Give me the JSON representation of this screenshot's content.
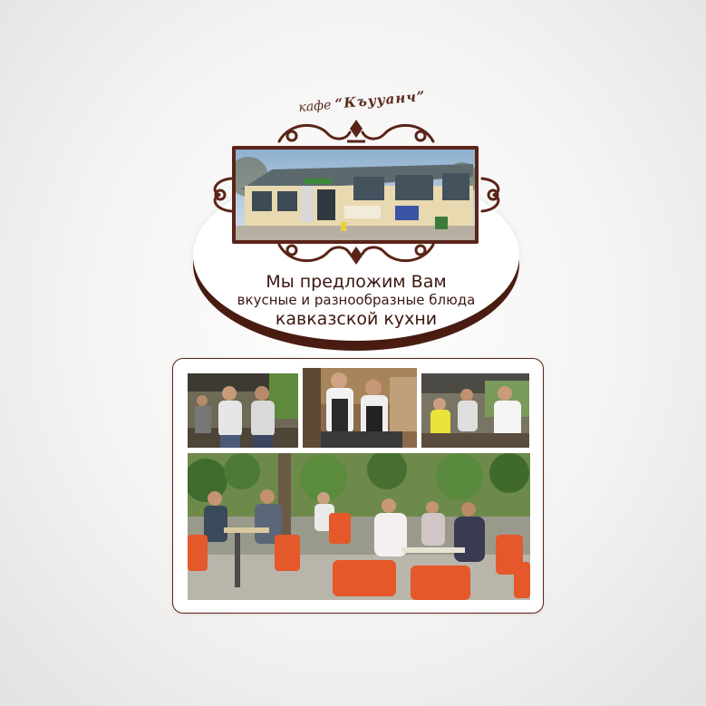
{
  "header": {
    "cafe_prefix": "кафе",
    "cafe_name": "“Къууанч”"
  },
  "slogan": {
    "line1": "Мы предложим Вам",
    "line2": "вкусные и разнообразные блюда",
    "line3": "кавказской кухни"
  },
  "colors": {
    "brand_brown": "#5b2418",
    "text_brown": "#3b1710",
    "background": "#f4f3f2"
  },
  "icons": {
    "ornaments": [
      "top-scroll-ornament-icon",
      "bottom-scroll-ornament-icon",
      "left-scroll-ornament-icon",
      "right-scroll-ornament-icon"
    ]
  }
}
